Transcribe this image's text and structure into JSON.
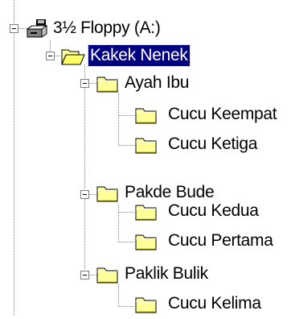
{
  "tree": {
    "root": {
      "label": "3½ Floppy (A:)",
      "icon": "floppy-drive-icon",
      "toggle": "minus"
    },
    "nodes": [
      {
        "label": "Kakek Nenek",
        "icon": "folder-open-icon",
        "toggle": "minus",
        "selected": true
      },
      {
        "label": "Ayah Ibu",
        "icon": "folder-icon",
        "toggle": "minus"
      },
      {
        "label": "Cucu Keempat",
        "icon": "folder-icon"
      },
      {
        "label": "Cucu Ketiga",
        "icon": "folder-icon"
      },
      {
        "label": "Pakde Bude",
        "icon": "folder-icon",
        "toggle": "minus"
      },
      {
        "label": "Cucu Kedua",
        "icon": "folder-icon"
      },
      {
        "label": "Cucu Pertama",
        "icon": "folder-icon"
      },
      {
        "label": "Paklik Bulik",
        "icon": "folder-icon",
        "toggle": "minus"
      },
      {
        "label": "Cucu Kelima",
        "icon": "folder-icon"
      }
    ]
  },
  "colors": {
    "selection_bg": "#000080",
    "selection_fg": "#ffffff",
    "folder": "#ffff99",
    "tree_line": "#808080"
  }
}
